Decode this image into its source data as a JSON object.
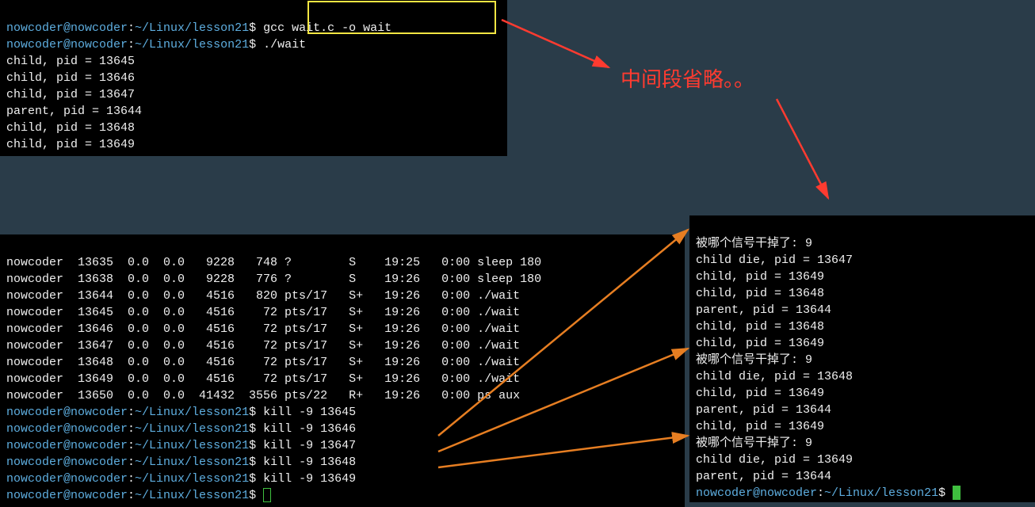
{
  "annotation": {
    "text": "中间段省略。。"
  },
  "prompt": {
    "user": "nowcoder@nowcoder",
    "path": "~/Linux/lesson21",
    "sep": ":",
    "end": "$"
  },
  "top_terminal": {
    "cmd1": "gcc wait.c -o wait",
    "cmd2": "./wait",
    "lines": [
      "child, pid = 13645",
      "child, pid = 13646",
      "child, pid = 13647",
      "parent, pid = 13644",
      "child, pid = 13648",
      "child, pid = 13649"
    ]
  },
  "bl_terminal": {
    "ps_header_rows": [
      "nowcoder  13635  0.0  0.0   9228   748 ?        S    19:25   0:00 sleep 180",
      "nowcoder  13638  0.0  0.0   9228   776 ?        S    19:26   0:00 sleep 180",
      "nowcoder  13644  0.0  0.0   4516   820 pts/17   S+   19:26   0:00 ./wait",
      "nowcoder  13645  0.0  0.0   4516    72 pts/17   S+   19:26   0:00 ./wait",
      "nowcoder  13646  0.0  0.0   4516    72 pts/17   S+   19:26   0:00 ./wait",
      "nowcoder  13647  0.0  0.0   4516    72 pts/17   S+   19:26   0:00 ./wait",
      "nowcoder  13648  0.0  0.0   4516    72 pts/17   S+   19:26   0:00 ./wait",
      "nowcoder  13649  0.0  0.0   4516    72 pts/17   S+   19:26   0:00 ./wait",
      "nowcoder  13650  0.0  0.0  41432  3556 pts/22   R+   19:26   0:00 ps aux"
    ],
    "kill_cmds": [
      "kill -9 13645",
      "kill -9 13646",
      "kill -9 13647",
      "kill -9 13648",
      "kill -9 13649"
    ]
  },
  "br_terminal": {
    "lines": [
      "被哪个信号干掉了: 9",
      "child die, pid = 13647",
      "child, pid = 13649",
      "child, pid = 13648",
      "parent, pid = 13644",
      "child, pid = 13648",
      "child, pid = 13649",
      "被哪个信号干掉了: 9",
      "child die, pid = 13648",
      "child, pid = 13649",
      "parent, pid = 13644",
      "child, pid = 13649",
      "被哪个信号干掉了: 9",
      "child die, pid = 13649",
      "parent, pid = 13644"
    ]
  }
}
